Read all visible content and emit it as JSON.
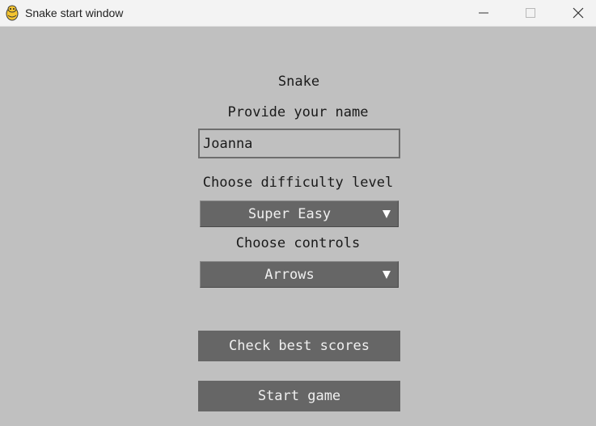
{
  "window": {
    "title": "Snake start window",
    "icon": "pygame-snake-icon"
  },
  "controls_bar": {
    "minimize_icon": "minimize-icon",
    "maximize_icon": "maximize-icon",
    "close_icon": "close-icon"
  },
  "form": {
    "heading": "Snake",
    "name_label": "Provide your name",
    "name_value": "Joanna",
    "difficulty_label": "Choose difficulty level",
    "difficulty_value": "Super Easy",
    "controls_label": "Choose controls",
    "controls_value": "Arrows"
  },
  "buttons": {
    "best_scores": "Check best scores",
    "start_game": "Start game"
  },
  "colors": {
    "background": "#c0c0c0",
    "button_fill": "#666666",
    "button_text": "#f0f0f0",
    "titlebar": "#f3f3f3"
  }
}
